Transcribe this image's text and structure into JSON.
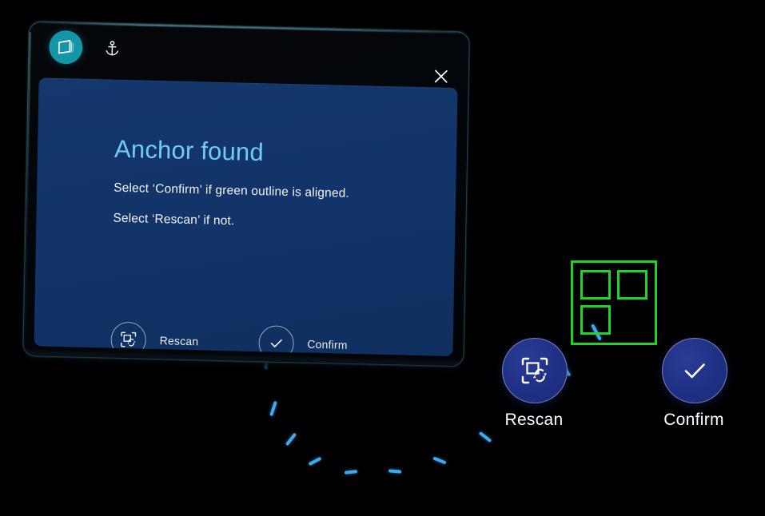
{
  "window": {
    "app_icon": "screen-parallelogram-icon",
    "anchor_icon": "anchor-icon",
    "close_icon": "close-x-icon",
    "accent_teal": "#1596a8"
  },
  "dialog": {
    "heading": "Anchor found",
    "heading_color": "#6ecdf0",
    "line1": "Select ‘Confirm’ if green outline is aligned.",
    "line2": "Select ‘Rescan’ if not.",
    "panel_color": "#123468",
    "actions": [
      {
        "label": "Rescan",
        "icon": "scan-refresh-icon"
      },
      {
        "label": "Confirm",
        "icon": "checkmark-icon"
      }
    ]
  },
  "spatial_buttons": [
    {
      "label": "Rescan",
      "icon": "scan-refresh-icon",
      "fill": "#1f2f84"
    },
    {
      "label": "Confirm",
      "icon": "checkmark-icon",
      "fill": "#1f2f84"
    }
  ],
  "anchor_marker": {
    "name": "green-anchor-outline",
    "color": "#22d12a",
    "inner_squares": 3
  },
  "connector": {
    "name": "dashed-pointer-trail",
    "color": "#3fa9ef",
    "dash_count": 11
  }
}
